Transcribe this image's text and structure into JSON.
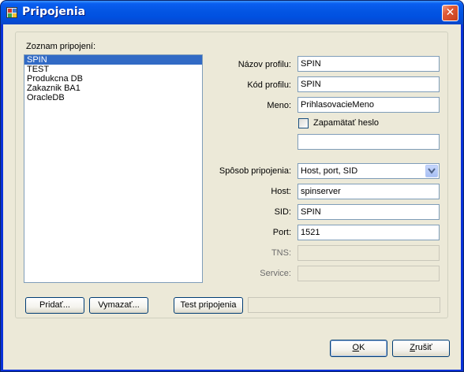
{
  "window": {
    "title": "Pripojenia",
    "close_glyph": "✕"
  },
  "connections": {
    "label": "Zoznam pripojení:",
    "items": [
      "SPIN",
      "TEST",
      "Produkcna DB",
      "Zakaznik BA1",
      "OracleDB"
    ],
    "selected_index": 0
  },
  "form": {
    "profile_name": {
      "label": "Názov profilu:",
      "value": "SPIN"
    },
    "profile_code": {
      "label": "Kód profilu:",
      "value": "SPIN"
    },
    "username": {
      "label": "Meno:",
      "value": "PrihlasovacieMeno"
    },
    "remember_password": {
      "label": "Zapamätať heslo",
      "checked": false
    },
    "password": {
      "value": ""
    },
    "connection_method": {
      "label": "Spôsob pripojenia:",
      "value": "Host, port, SID",
      "arrow_icon": "chevron-down-icon"
    },
    "host": {
      "label": "Host:",
      "value": "spinserver"
    },
    "sid": {
      "label": "SID:",
      "value": "SPIN"
    },
    "port": {
      "label": "Port:",
      "value": "1521"
    },
    "tns": {
      "label": "TNS:",
      "value": ""
    },
    "service": {
      "label": "Service:",
      "value": ""
    }
  },
  "buttons": {
    "add": "Pridať...",
    "delete": "Vymazať...",
    "test": "Test pripojenia",
    "ok_prefix": "",
    "ok_underlined": "O",
    "ok_suffix": "K",
    "cancel_prefix": "",
    "cancel_underlined": "Z",
    "cancel_suffix": "rušiť"
  },
  "colors": {
    "titlebar": "#0355e3",
    "selection": "#316ac5",
    "dialog_bg": "#ece9d8",
    "close_button": "#e05a36"
  }
}
